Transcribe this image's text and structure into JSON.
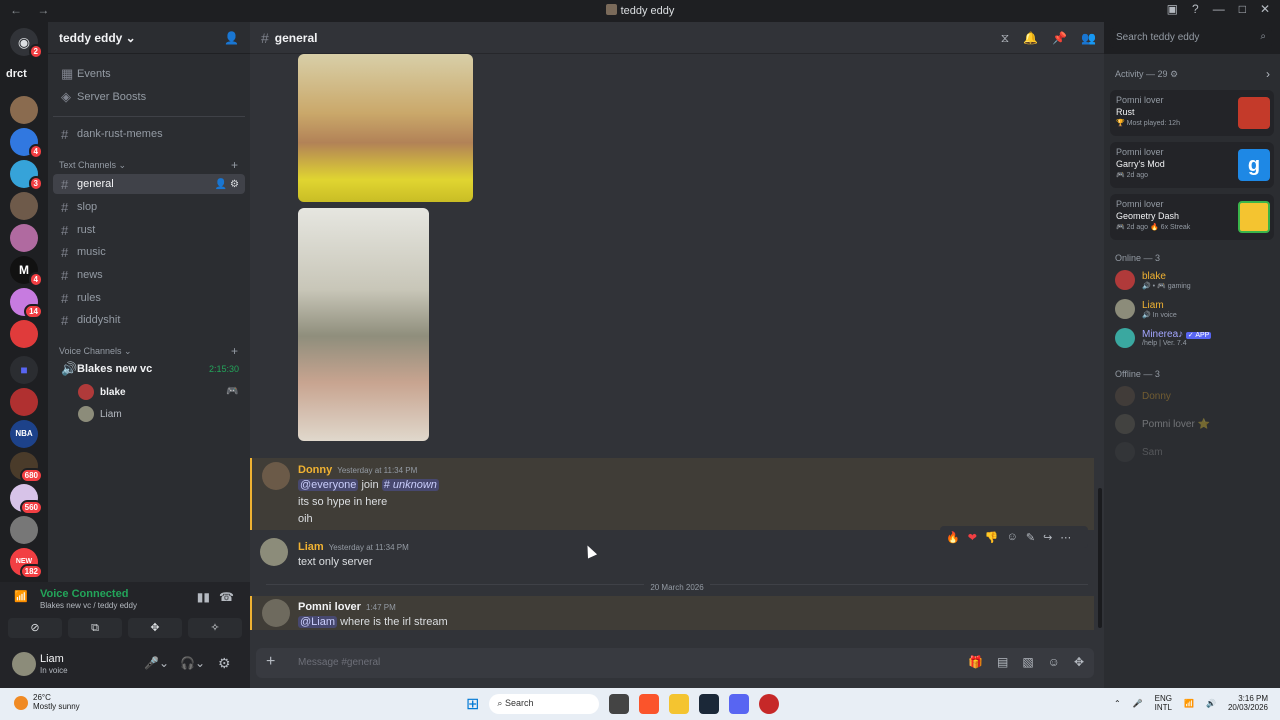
{
  "window": {
    "title": "teddy eddy",
    "nav": "← →"
  },
  "guild": {
    "name": "teddy eddy ⌄"
  },
  "servers": {
    "drct": "drct",
    "new_label": "NEW",
    "badges": [
      "2",
      "4",
      "4",
      "3",
      "4",
      "14",
      "680",
      "560",
      "182"
    ]
  },
  "channels": {
    "top": [
      {
        "label": "Events"
      },
      {
        "label": "Server Boosts"
      }
    ],
    "pinned": "dank-rust-memes",
    "text_category": "Text Channels",
    "text": [
      "general",
      "slop",
      "rust",
      "music",
      "news",
      "rules",
      "diddyshit"
    ],
    "voice_category": "Voice Channels",
    "voice_channel": "Blakes new vc",
    "voice_time": "2:15:30",
    "voice_users": [
      "blake",
      "Liam"
    ]
  },
  "voice_panel": {
    "status": "Voice Connected",
    "sub": "Blakes new vc / teddy eddy"
  },
  "user_panel": {
    "name": "Liam",
    "status": "In voice"
  },
  "chat": {
    "channel": "general",
    "messages": [
      {
        "author": "Donny",
        "time": "Yesterday at 11:34 PM",
        "mention": "@everyone",
        "text1": "join",
        "channel_link": "# unknown",
        "line2": "its so hype in here",
        "line3": "oih",
        "color": "#f0b232"
      },
      {
        "author": "Liam",
        "time": "Yesterday at 11:34 PM",
        "line": "text only server",
        "color": "#f0b232"
      },
      {
        "author": "Pomni lover",
        "time": "1:47 PM",
        "mention": "@Liam",
        "line": "where is the irl stream",
        "color": "#f2f3f5"
      }
    ],
    "date_divider": "20 March 2026",
    "composer_placeholder": "Message #general"
  },
  "search": {
    "placeholder": "Search teddy eddy"
  },
  "members": {
    "activity_header": "Activity — 29 ⚙",
    "activities": [
      {
        "user": "Pomni lover",
        "game": "Rust",
        "sub": "🏆 Most played: 12h",
        "color": "#c43a2a"
      },
      {
        "user": "Pomni lover",
        "game": "Garry's Mod",
        "sub": "🎮 2d ago",
        "color": "#1e88e5"
      },
      {
        "user": "Pomni lover",
        "game": "Geometry Dash",
        "sub": "🎮 2d ago  🔥 6x Streak",
        "color": "#f4c430"
      }
    ],
    "online_header": "Online — 3",
    "online": [
      {
        "name": "blake",
        "status": "🔊 • 🎮 gaming",
        "color": "#f0b232"
      },
      {
        "name": "Liam",
        "status": "🔊 In voice",
        "color": "#f0b232"
      },
      {
        "name": "Minerea♪",
        "status": "/help | Ver. 7.4",
        "color": "#a3a6ff",
        "tag": "✓ APP"
      }
    ],
    "offline_header": "Offline — 3",
    "offline": [
      {
        "name": "Donny"
      },
      {
        "name": "Pomni lover ⭐"
      },
      {
        "name": "Sam"
      }
    ]
  },
  "taskbar": {
    "temp": "26°C",
    "weather": "Mostly sunny",
    "search": "Search",
    "lang": "ENG",
    "lang2": "INTL",
    "time": "3:16 PM",
    "date": "20/03/2026"
  }
}
